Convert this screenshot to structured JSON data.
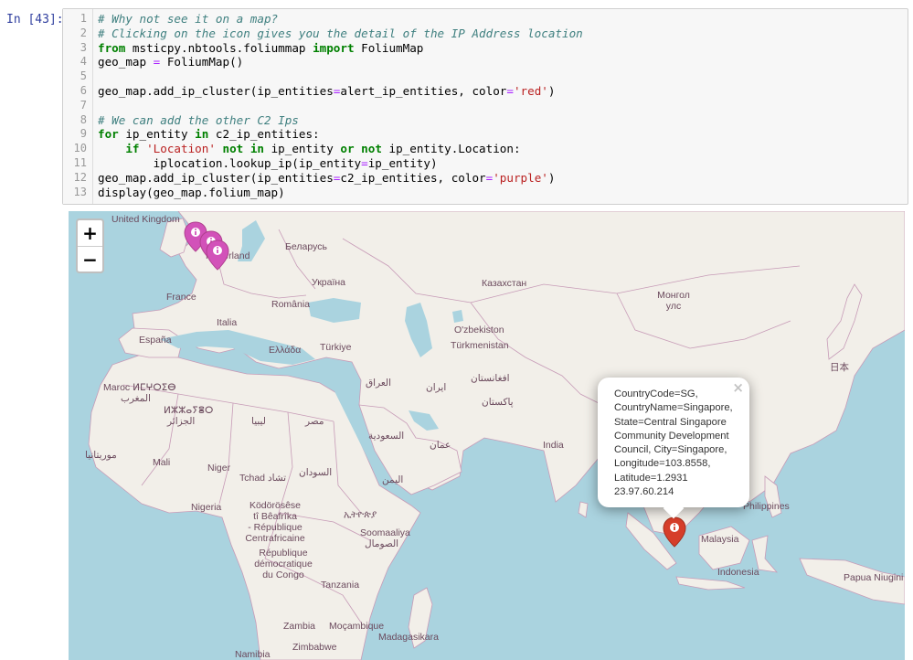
{
  "cell": {
    "prompt": "In [43]:",
    "line_numbers": [
      "1",
      "2",
      "3",
      "4",
      "5",
      "6",
      "7",
      "8",
      "9",
      "10",
      "11",
      "12",
      "13"
    ]
  },
  "code": {
    "l1": "# Why not see it on a map?",
    "l2": "# Clicking on the icon gives you the detail of the IP Address location",
    "l3_kw1": "from",
    "l3_mod": " msticpy.nbtools.foliummap ",
    "l3_kw2": "import",
    "l3_name": " FoliumMap",
    "l4_a": "geo_map ",
    "l4_op": "=",
    "l4_b": " FoliumMap()",
    "l6_a": "geo_map.add_ip_cluster(ip_entities",
    "l6_op1": "=",
    "l6_b": "alert_ip_entities, color",
    "l6_op2": "=",
    "l6_str": "'red'",
    "l6_c": ")",
    "l8": "# We can add the other C2 Ips",
    "l9_kw1": "for",
    "l9_a": " ip_entity ",
    "l9_kw2": "in",
    "l9_b": " c2_ip_entities:",
    "l10_indent": "    ",
    "l10_kw1": "if",
    "l10_str": " 'Location'",
    "l10_kw2": " not in",
    "l10_a": " ip_entity ",
    "l10_kw3": "or not",
    "l10_b": " ip_entity.Location:",
    "l11_a": "        iplocation.lookup_ip(ip_entity",
    "l11_op": "=",
    "l11_b": "ip_entity)",
    "l12_a": "geo_map.add_ip_cluster(ip_entities",
    "l12_op1": "=",
    "l12_b": "c2_ip_entities, color",
    "l12_op2": "=",
    "l12_str": "'purple'",
    "l12_c": ")",
    "l13": "display(geo_map.folium_map)"
  },
  "map": {
    "zoom_in_label": "+",
    "zoom_out_label": "−",
    "labels": {
      "united_kingdom": "United Kingdom",
      "nederland": "Nederland",
      "belarus": "Беларусь",
      "ukraine": "Україна",
      "kazakhstan": "Казахстан",
      "mongolia_1": "Монгол",
      "mongolia_2": "улс",
      "france": "France",
      "romania": "România",
      "italia": "Italia",
      "uzbekistan": "O'zbekiston",
      "turkmenistan": "Türkmenistan",
      "espana": "España",
      "ellada": "Ελλάδα",
      "turkiye": "Türkiye",
      "japan": "日本",
      "maroc": "Maroc ⵍⵎⵖⵔⵉⴱ",
      "maghrib": "المغرب",
      "iraq": "العراق",
      "iran": "ایران",
      "afghanistan": "افغانستان",
      "algeria_tf": "ⵍⵣⵣⴰⵢⴻⵔ",
      "algeria_ar": "الجزائر",
      "libya": "ليبيا",
      "egypt": "مصر",
      "pakistan": "پاکستان",
      "saudi": "السعودية",
      "oman": "عمان",
      "india": "India",
      "mauritania": "موريتانيا",
      "mali": "Mali",
      "niger": "Niger",
      "tchad": "Tchad تشاد",
      "sudan": "السودان",
      "yemen": "اليمن",
      "nigeria": "Nigeria",
      "car_1": "Ködörösêse",
      "car_2": "tî Bêafrîka",
      "car_3": "- République",
      "car_4": "Centrafricaine",
      "ethiopia": "ኢትዮጵያ",
      "somalia_1": "Soomaaliya",
      "somalia_2": "الصومال",
      "drc_1": "République",
      "drc_2": "démocratique",
      "drc_3": "du Congo",
      "tanzania": "Tanzania",
      "philippines": "Philippines",
      "malaysia": "Malaysia",
      "indonesia": "Indonesia",
      "papua": "Papua Niugini",
      "zambia": "Zambia",
      "mocambique": "Moçambique",
      "madagasikara": "Madagasikara",
      "namibia": "Namibia",
      "zimbabwe": "Zimbabwe"
    },
    "popup": {
      "close": "×",
      "line1": "CountryCode=SG,",
      "line2": "CountryName=Singapore,",
      "line3": "State=Central Singapore",
      "line4": "Community Development",
      "line5": "Council, City=Singapore,",
      "line6": "Longitude=103.8558,",
      "line7": "Latitude=1.2931",
      "line8": "23.97.60.214"
    },
    "marker_colors": {
      "alert": "#d63e2a",
      "c2": "#d252b9"
    },
    "marker_icon": "info-sign-icon"
  }
}
